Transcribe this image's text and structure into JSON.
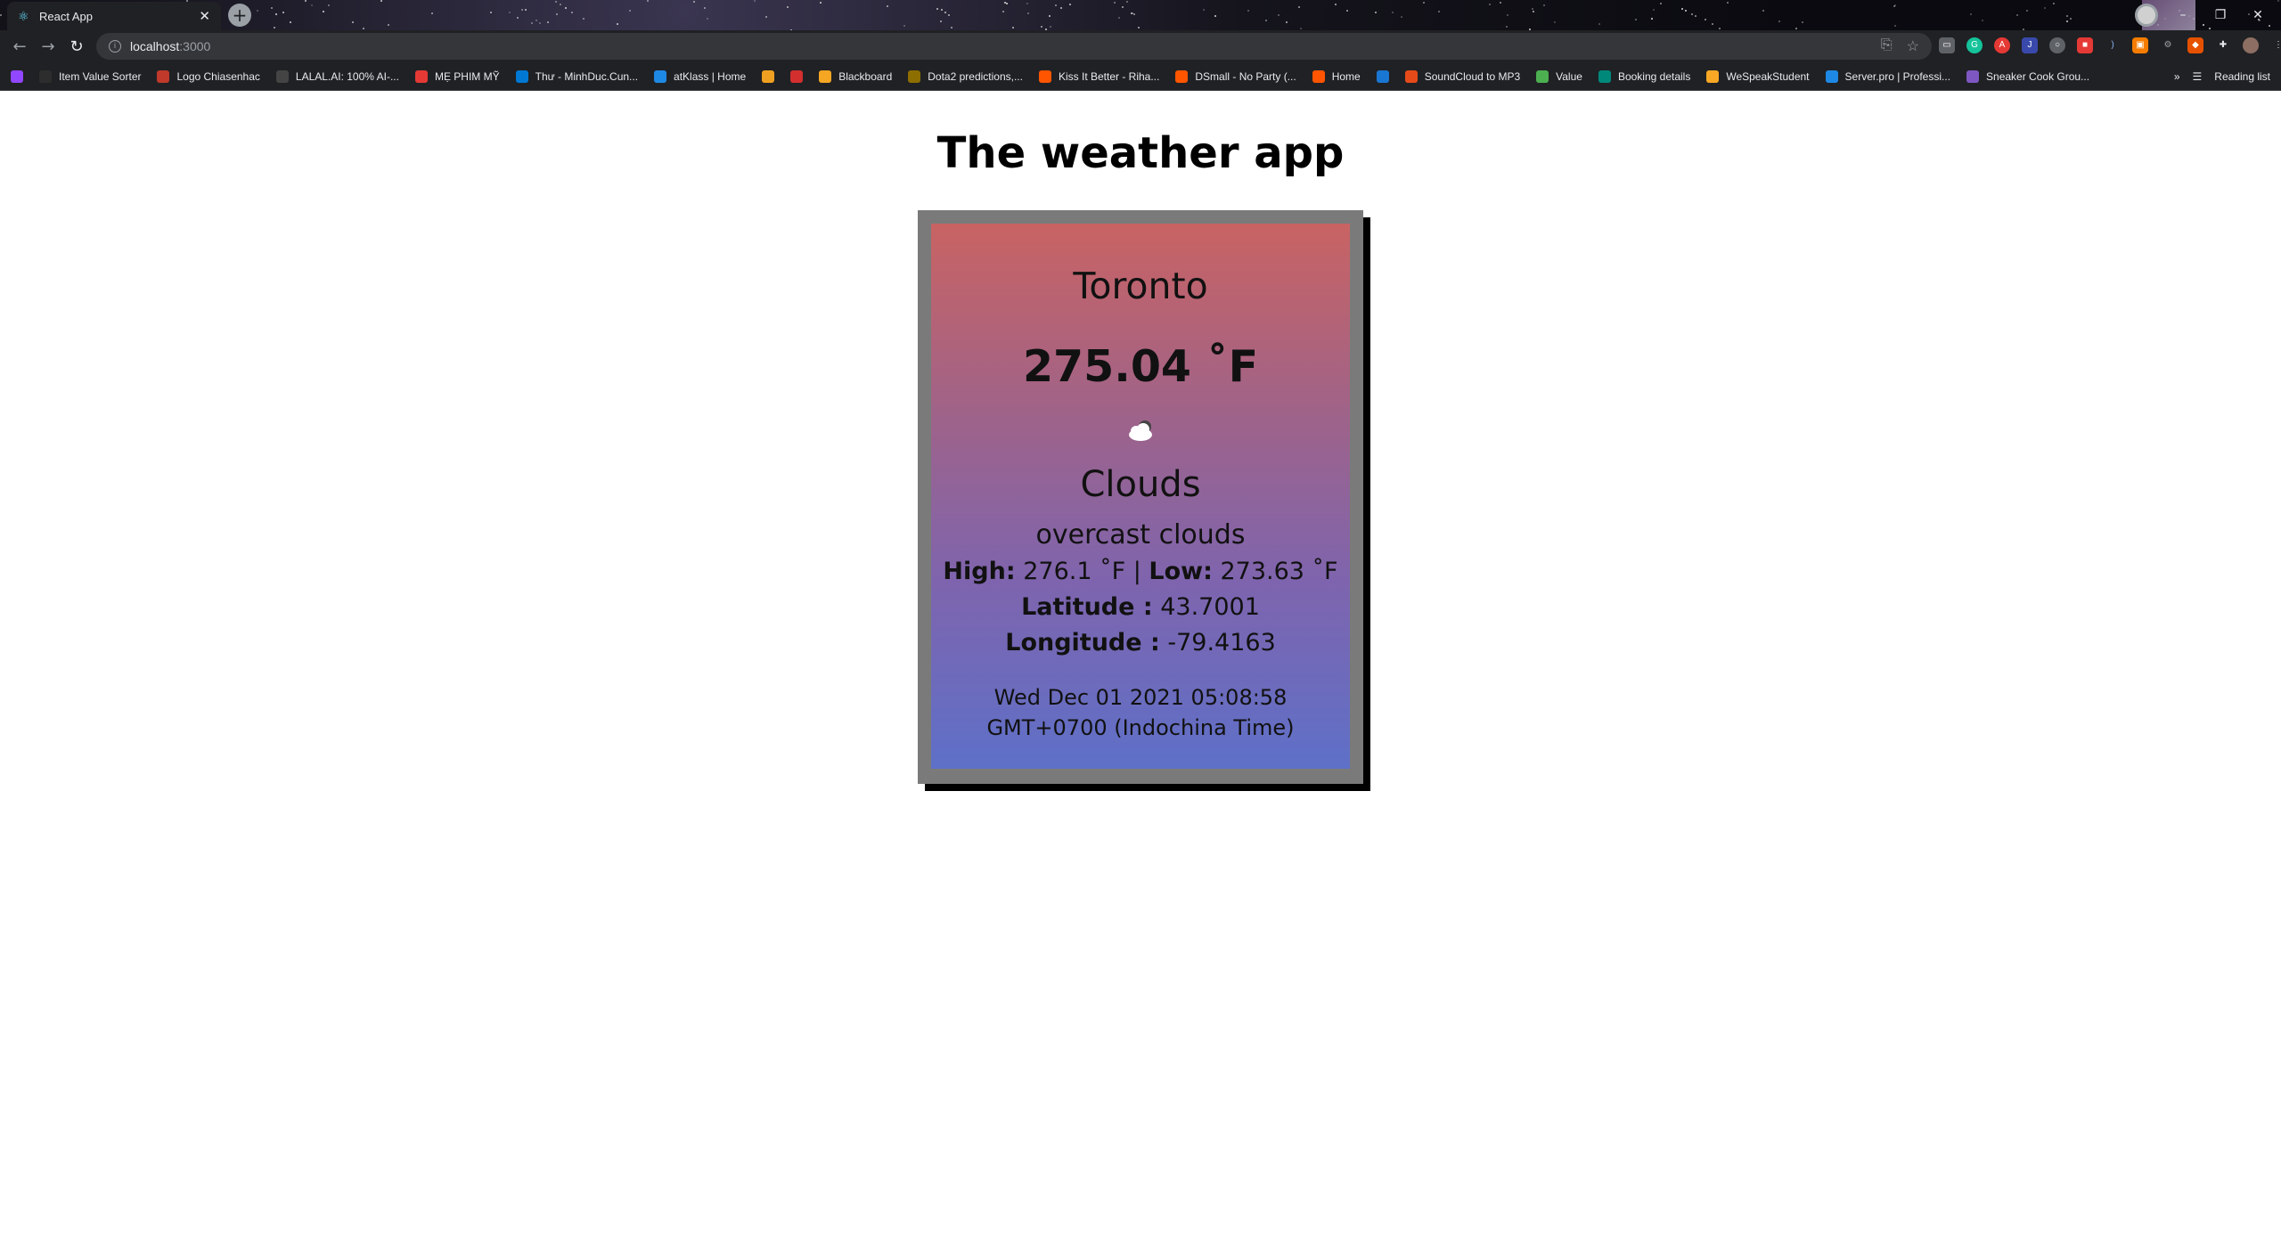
{
  "browser": {
    "tab_title": "React App",
    "url_host": "localhost",
    "url_port": ":3000",
    "bookmarks": [
      {
        "label": "",
        "color": "#9146ff"
      },
      {
        "label": "Item Value Sorter",
        "color": "#2d2d2d"
      },
      {
        "label": "Logo Chiasenhac",
        "color": "#c0392b"
      },
      {
        "label": "LALAL.AI: 100% AI-...",
        "color": "#444444"
      },
      {
        "label": "MẸ PHIM MỸ",
        "color": "#e53935"
      },
      {
        "label": "Thư - MinhDuc.Cun...",
        "color": "#0078d4"
      },
      {
        "label": "atKlass | Home",
        "color": "#1e88e5"
      },
      {
        "label": "",
        "color": "#f0a020"
      },
      {
        "label": "",
        "color": "#d32f2f"
      },
      {
        "label": "Blackboard",
        "color": "#f5a623"
      },
      {
        "label": "Dota2 predictions,...",
        "color": "#8d6e00"
      },
      {
        "label": "Kiss It Better - Riha...",
        "color": "#ff5500"
      },
      {
        "label": "DSmall - No Party (...",
        "color": "#ff5500"
      },
      {
        "label": "Home",
        "color": "#ff5500"
      },
      {
        "label": "",
        "color": "#1976d2"
      },
      {
        "label": "SoundCloud to MP3",
        "color": "#e64a19"
      },
      {
        "label": "Value",
        "color": "#4caf50"
      },
      {
        "label": "Booking details",
        "color": "#00897b"
      },
      {
        "label": "WeSpeakStudent",
        "color": "#f9a825"
      },
      {
        "label": "Server.pro | Professi...",
        "color": "#1e88e5"
      },
      {
        "label": "Sneaker Cook Grou...",
        "color": "#7e57c2"
      }
    ],
    "more_bookmarks": "»",
    "reading_list": "Reading list"
  },
  "page": {
    "title": "The weather app"
  },
  "weather": {
    "city": "Toronto",
    "temperature": "275.04 ˚F",
    "icon": "cloud-icon",
    "condition": "Clouds",
    "description": "overcast clouds",
    "high_label": "High:",
    "high_value": " 276.1 ˚F | ",
    "low_label": "Low:",
    "low_value": " 273.63 ˚F",
    "latitude_label": "Latitude :",
    "latitude_value": " 43.7001",
    "longitude_label": "Longitude :",
    "longitude_value": " -79.4163",
    "date": "Wed Dec 01 2021 05:08:58 GMT+0700 (Indochina Time)"
  },
  "colors": {
    "card_top": "#c96363",
    "card_bottom": "#5e70c8",
    "frame": "#7a7a7a"
  }
}
